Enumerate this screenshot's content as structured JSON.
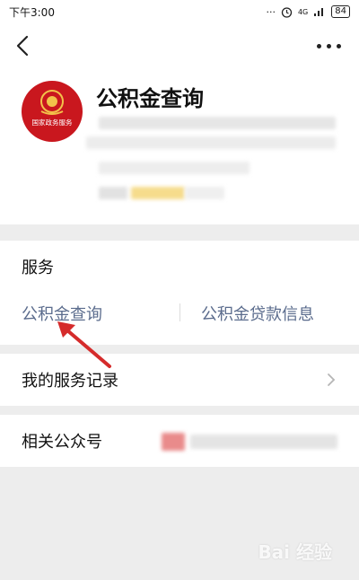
{
  "statusbar": {
    "time": "下午3:00",
    "network": "4G",
    "battery": "84"
  },
  "account": {
    "name": "公积金查询",
    "logo_text": "国家政务服务"
  },
  "services": {
    "title": "服务",
    "items": [
      {
        "label": "公积金查询"
      },
      {
        "label": "公积金贷款信息"
      }
    ]
  },
  "records": {
    "label": "我的服务记录"
  },
  "related": {
    "label": "相关公众号"
  },
  "watermark": {
    "text": "Bai 经验"
  },
  "colors": {
    "accent_link": "#5b6c8d",
    "logo_red": "#c9171e",
    "arrow_red": "#d52b2b"
  }
}
